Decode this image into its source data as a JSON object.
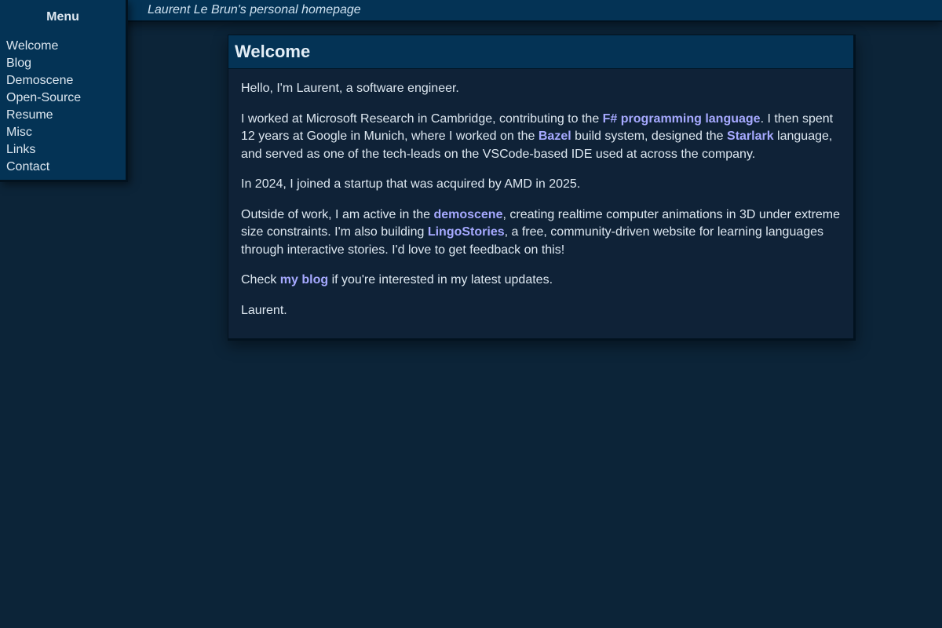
{
  "header": {
    "site_title": "Laurent Le Brun's personal homepage"
  },
  "menu": {
    "title": "Menu",
    "items": [
      {
        "label": "Welcome"
      },
      {
        "label": "Blog"
      },
      {
        "label": "Demoscene"
      },
      {
        "label": "Open-Source"
      },
      {
        "label": "Resume"
      },
      {
        "label": "Misc"
      },
      {
        "label": "Links"
      },
      {
        "label": "Contact"
      }
    ]
  },
  "main": {
    "title": "Welcome",
    "paragraphs": [
      {
        "text": "Hello, I'm Laurent, a software engineer."
      },
      {
        "t1": "I worked at Microsoft Research in Cambridge, contributing to the ",
        "link1": "F# programming language",
        "t2": ". I then spent 12 years at Google in Munich, where I worked on the ",
        "link2": "Bazel",
        "t3": " build system, designed the ",
        "link3": "Starlark",
        "t4": " language, and served as one of the tech-leads on the VSCode-based IDE used at across the company."
      },
      {
        "text": "In 2024, I joined a startup that was acquired by AMD in 2025."
      },
      {
        "t1": "Outside of work, I am active in the ",
        "link1": "demoscene",
        "t2": ", creating realtime computer animations in 3D under extreme size constraints. I'm also building ",
        "link2": "LingoStories",
        "t3": ", a free, community-driven website for learning languages through interactive stories. I'd love to get feedback on this!"
      },
      {
        "t1": "Check ",
        "link1": "my blog",
        "t2": " if you're interested in my latest updates."
      },
      {
        "text": "Laurent."
      }
    ]
  },
  "colors": {
    "background": "#0c2438",
    "bar": "#043355",
    "panel": "#0f2237",
    "link": "#a6a9ff",
    "text": "#dde7f0"
  }
}
